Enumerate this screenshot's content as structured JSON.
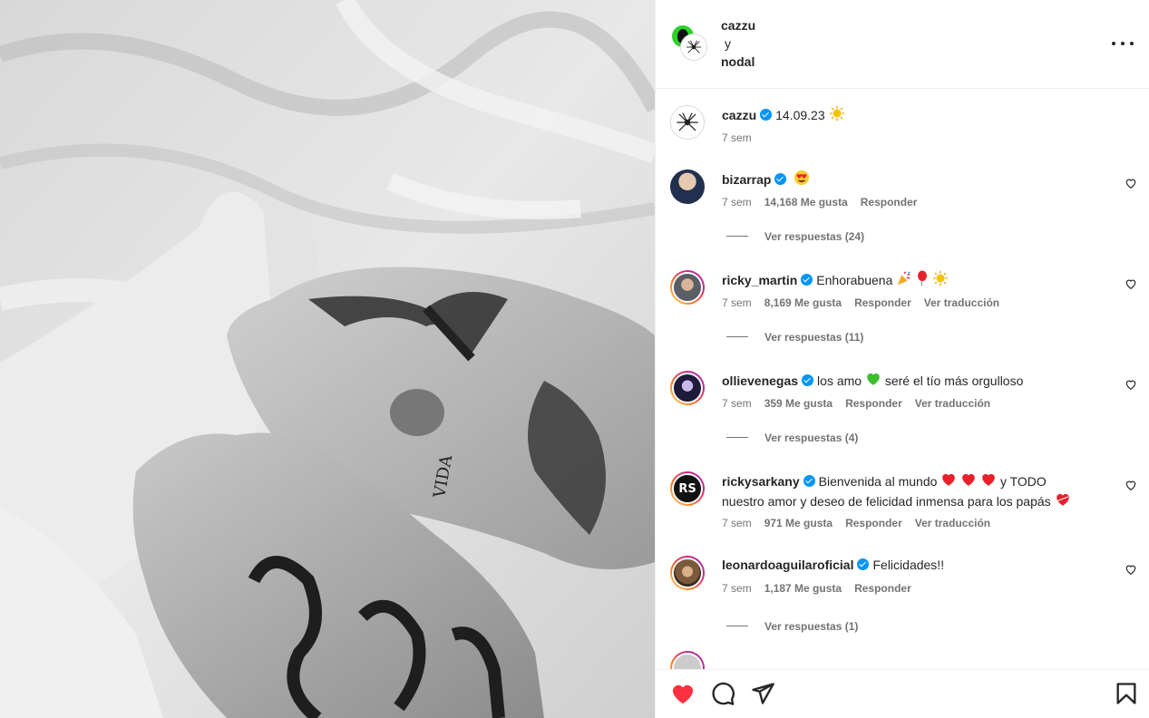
{
  "header": {
    "user1": "cazzu",
    "separator": "y",
    "user2": "nodal"
  },
  "caption": {
    "username": "cazzu",
    "text": "14.09.23",
    "time": "7 sem"
  },
  "comments": [
    {
      "username": "bizarrap",
      "text": "",
      "time": "7 sem",
      "likes": "14,168 Me gusta",
      "reply": "Responder",
      "translate": "",
      "replies": "Ver respuestas (24)"
    },
    {
      "username": "ricky_martin",
      "text": "Enhorabuena",
      "time": "7 sem",
      "likes": "8,169 Me gusta",
      "reply": "Responder",
      "translate": "Ver traducción",
      "replies": "Ver respuestas (11)"
    },
    {
      "username": "ollievenegas",
      "text": "los amo",
      "text2": "seré el tío más orgulloso",
      "time": "7 sem",
      "likes": "359 Me gusta",
      "reply": "Responder",
      "translate": "Ver traducción",
      "replies": "Ver respuestas (4)"
    },
    {
      "username": "rickysarkany",
      "text": "Bienvenida al mundo",
      "text2": "y TODO",
      "text3": "nuestro amor y deseo de felicidad inmensa para los papás",
      "time": "7 sem",
      "likes": "971 Me gusta",
      "reply": "Responder",
      "translate": "Ver traducción"
    },
    {
      "username": "leonardoaguilaroficial",
      "text": "Felicidades!!",
      "time": "7 sem",
      "likes": "1,187 Me gusta",
      "reply": "Responder",
      "translate": "",
      "replies": "Ver respuestas (1)"
    }
  ],
  "icons": {
    "like": "heart-filled-icon",
    "comment": "comment-icon",
    "share": "send-icon",
    "save": "bookmark-icon",
    "more": "more-options-icon"
  },
  "colors": {
    "like_red": "#ff3040",
    "verified_blue": "#0095f6",
    "secondary_text": "#737373"
  }
}
